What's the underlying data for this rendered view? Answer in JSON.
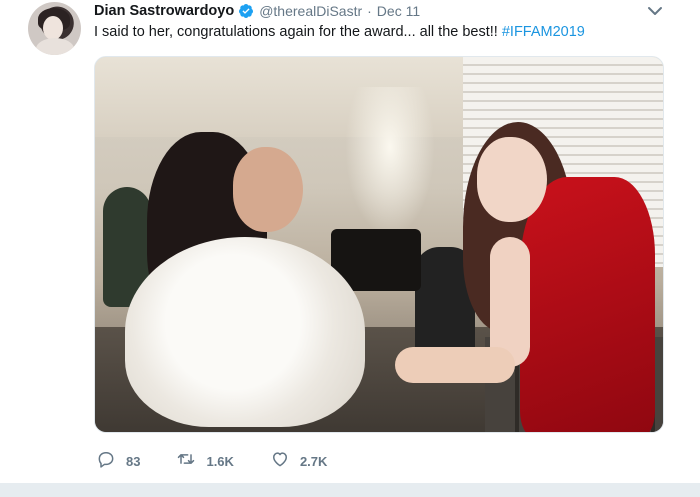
{
  "tweet": {
    "author_name": "Dian Sastrowardoyo",
    "handle": "@therealDiSastr",
    "separator": "·",
    "date": "Dec 11",
    "text": "I said to her, congratulations again for the award... all the best!! ",
    "hashtag": "#IFFAM2019",
    "verified_icon": "verified-badge-icon",
    "caret_icon": "chevron-down-icon",
    "photo_icon": "tweet-photo"
  },
  "actions": {
    "reply": {
      "icon": "reply-icon",
      "count": "83"
    },
    "retweet": {
      "icon": "retweet-icon",
      "count": "1.6K"
    },
    "like": {
      "icon": "heart-icon",
      "count": "2.7K"
    }
  },
  "colors": {
    "link": "#1b95e0",
    "secondary_text": "#657786",
    "verified": "#1da1f2"
  }
}
